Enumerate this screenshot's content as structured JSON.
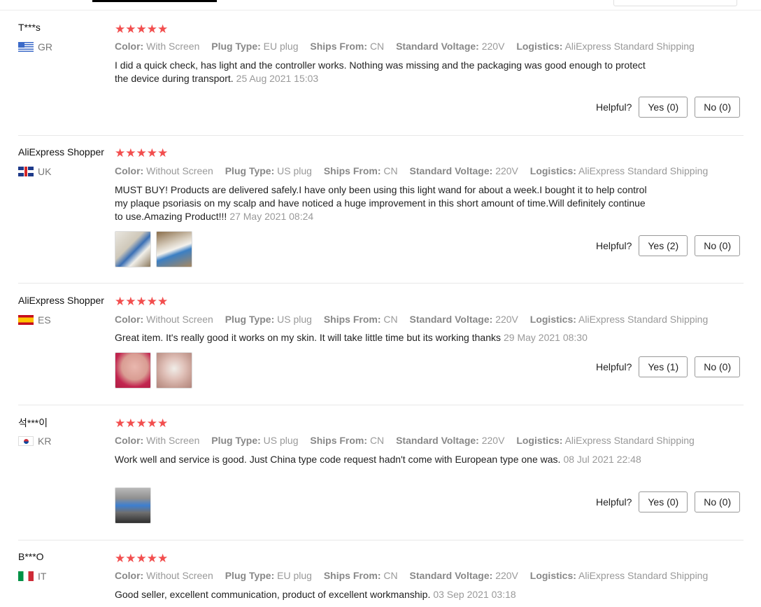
{
  "reviews": [
    {
      "user": "T***s",
      "country": "GR",
      "stars": "★★★★★",
      "attrs": [
        {
          "k": "Color:",
          "v": "With Screen"
        },
        {
          "k": "Plug Type:",
          "v": "EU plug"
        },
        {
          "k": "Ships From:",
          "v": "CN"
        },
        {
          "k": "Standard Voltage:",
          "v": "220V"
        },
        {
          "k": "Logistics:",
          "v": "AliExpress Standard Shipping"
        }
      ],
      "text": "I did a quick check, has light and the controller works. Nothing was missing and the packaging was good enough to protect the device during transport.",
      "date": "25 Aug 2021 15:03",
      "helpful_label": "Helpful?",
      "yes_label": "Yes (0)",
      "no_label": "No (0)"
    },
    {
      "user": "AliExpress Shopper",
      "country": "UK",
      "stars": "★★★★★",
      "attrs": [
        {
          "k": "Color:",
          "v": "Without Screen"
        },
        {
          "k": "Plug Type:",
          "v": "US plug"
        },
        {
          "k": "Ships From:",
          "v": "CN"
        },
        {
          "k": "Standard Voltage:",
          "v": "220V"
        },
        {
          "k": "Logistics:",
          "v": "AliExpress Standard Shipping"
        }
      ],
      "text": "MUST BUY! Products are delivered safely.I have only been using this light wand for about a week.I bought it to help control my plaque psoriasis on my scalp and have noticed a huge improvement in this short amount of time.Will definitely continue to use.Amazing Product!!!",
      "date": "27 May 2021 08:24",
      "helpful_label": "Helpful?",
      "yes_label": "Yes (2)",
      "no_label": "No (0)"
    },
    {
      "user": "AliExpress Shopper",
      "country": "ES",
      "stars": "★★★★★",
      "attrs": [
        {
          "k": "Color:",
          "v": "Without Screen"
        },
        {
          "k": "Plug Type:",
          "v": "US plug"
        },
        {
          "k": "Ships From:",
          "v": "CN"
        },
        {
          "k": "Standard Voltage:",
          "v": "220V"
        },
        {
          "k": "Logistics:",
          "v": "AliExpress Standard Shipping"
        }
      ],
      "text": "Great item. It's really good it works on my skin. It will take little time but its working thanks",
      "date": "29 May 2021 08:30",
      "helpful_label": "Helpful?",
      "yes_label": "Yes (1)",
      "no_label": "No (0)"
    },
    {
      "user": "석***이",
      "country": "KR",
      "stars": "★★★★★",
      "attrs": [
        {
          "k": "Color:",
          "v": "With Screen"
        },
        {
          "k": "Plug Type:",
          "v": "US plug"
        },
        {
          "k": "Ships From:",
          "v": "CN"
        },
        {
          "k": "Standard Voltage:",
          "v": "220V"
        },
        {
          "k": "Logistics:",
          "v": "AliExpress Standard Shipping"
        }
      ],
      "text": "Work well and service is good. Just China type code request hadn't come with European type one was.",
      "date": "08 Jul 2021 22:48",
      "helpful_label": "Helpful?",
      "yes_label": "Yes (0)",
      "no_label": "No (0)"
    },
    {
      "user": "B***O",
      "country": "IT",
      "stars": "★★★★★",
      "attrs": [
        {
          "k": "Color:",
          "v": "Without Screen"
        },
        {
          "k": "Plug Type:",
          "v": "EU plug"
        },
        {
          "k": "Ships From:",
          "v": "CN"
        },
        {
          "k": "Standard Voltage:",
          "v": "220V"
        },
        {
          "k": "Logistics:",
          "v": "AliExpress Standard Shipping"
        }
      ],
      "text": "Good seller, excellent communication, product of excellent workmanship.",
      "date": "03 Sep 2021 03:18"
    }
  ],
  "colors": {
    "star": "#f24e4e",
    "meta": "#999999",
    "divider": "#e8e8e8"
  }
}
